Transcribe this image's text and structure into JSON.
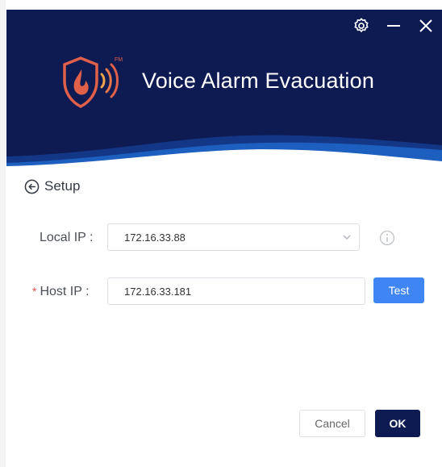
{
  "app": {
    "title": "Voice Alarm Evacuation",
    "logo_badge": "FM"
  },
  "window_controls": {
    "settings_icon": "gear-icon",
    "minimize_icon": "minimize-icon",
    "close_icon": "close-icon"
  },
  "nav": {
    "back_label": "Setup",
    "back_icon": "back-arrow-circle-icon"
  },
  "form": {
    "local_ip": {
      "label": "Local IP :",
      "value": "172.16.33.88",
      "info_icon": "info-icon"
    },
    "host_ip": {
      "required_mark": "*",
      "label": "Host IP :",
      "value": "172.16.33.181",
      "test_label": "Test"
    }
  },
  "footer": {
    "cancel_label": "Cancel",
    "ok_label": "OK"
  },
  "colors": {
    "header_bg": "#0d1b52",
    "wave": "#1e66c8",
    "primary_button": "#3f86f4",
    "ok_button": "#0d1b52",
    "required": "#e0504e"
  }
}
